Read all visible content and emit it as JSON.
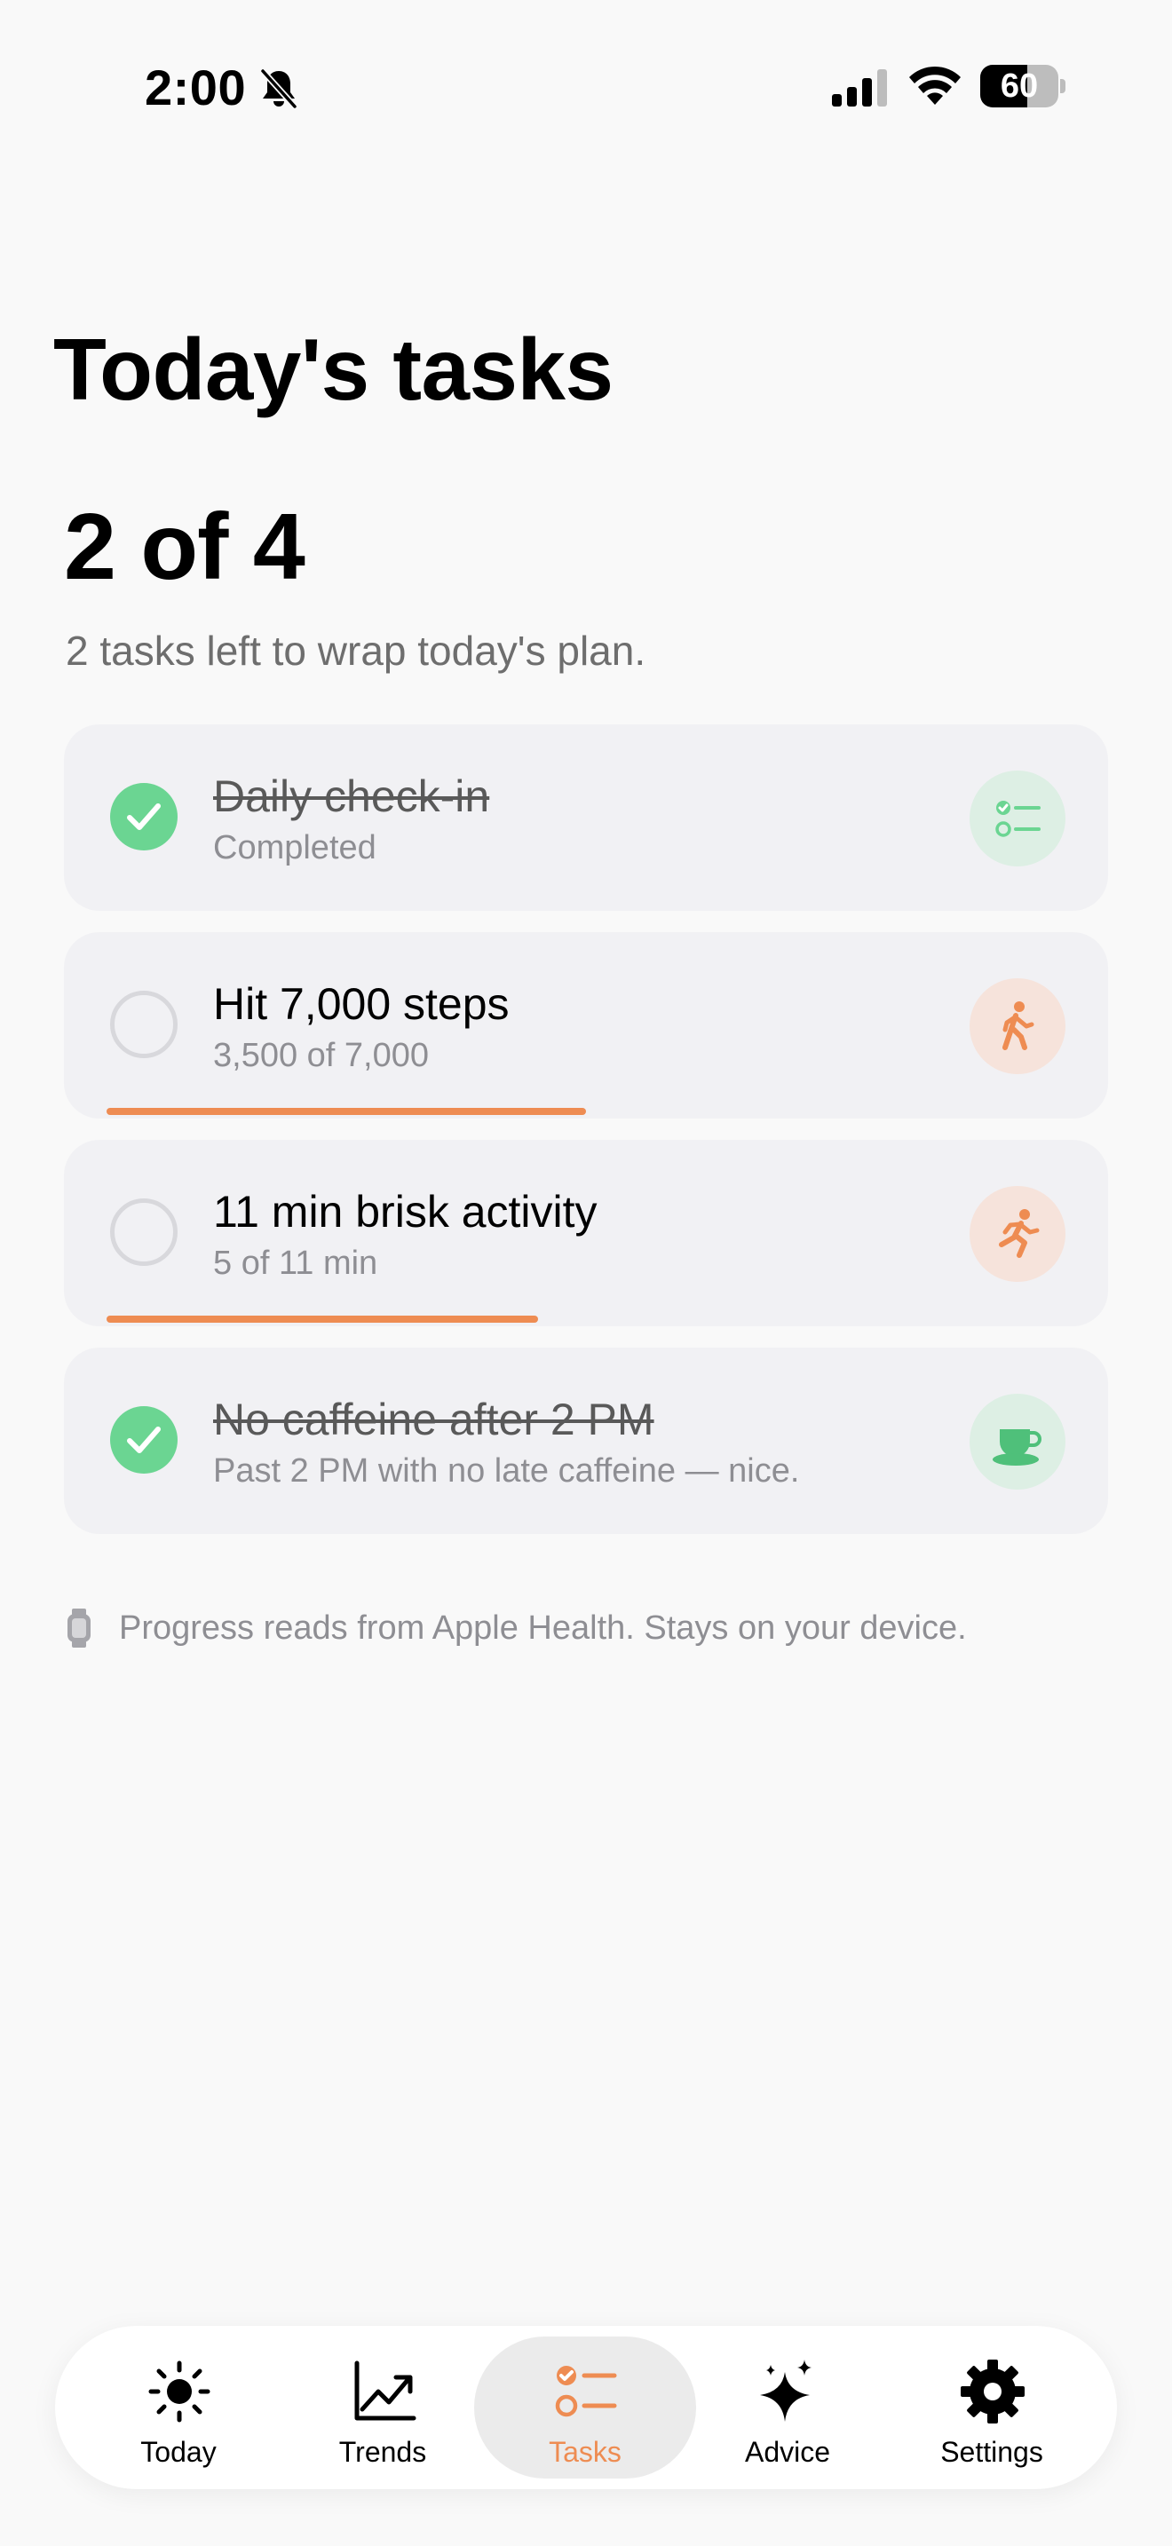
{
  "status_bar": {
    "time": "2:00",
    "battery_level": "60",
    "battery_fraction": 0.6
  },
  "header": {
    "title": "Today's tasks",
    "progress_count": "2 of 4",
    "progress_subtitle": "2 tasks left to wrap today's plan."
  },
  "tasks": [
    {
      "title": "Daily check-in",
      "detail": "Completed",
      "completed": true,
      "icon": "checklist-icon",
      "progress": null
    },
    {
      "title": "Hit 7,000 steps",
      "detail": "3,500 of 7,000",
      "completed": false,
      "icon": "walking-icon",
      "progress": 0.5
    },
    {
      "title": "11 min brisk activity",
      "detail": "5 of 11 min",
      "completed": false,
      "icon": "running-icon",
      "progress": 0.45
    },
    {
      "title": "No caffeine after 2 PM",
      "detail": "Past 2 PM with no late caffeine — nice.",
      "completed": true,
      "icon": "coffee-cup-icon",
      "progress": null
    }
  ],
  "footer": {
    "note": "Progress reads from Apple Health. Stays on your device.",
    "icon": "watch-icon"
  },
  "tab_bar": {
    "tabs": [
      {
        "label": "Today",
        "icon": "sun-icon",
        "active": false
      },
      {
        "label": "Trends",
        "icon": "chart-line-icon",
        "active": false
      },
      {
        "label": "Tasks",
        "icon": "checklist-icon",
        "active": true
      },
      {
        "label": "Advice",
        "icon": "sparkles-icon",
        "active": false
      },
      {
        "label": "Settings",
        "icon": "gear-icon",
        "active": false
      }
    ]
  },
  "colors": {
    "accent": "#EE8C52",
    "success": "#6BD592",
    "card_background": "#F1F1F4",
    "page_background": "#F9F9F9"
  }
}
